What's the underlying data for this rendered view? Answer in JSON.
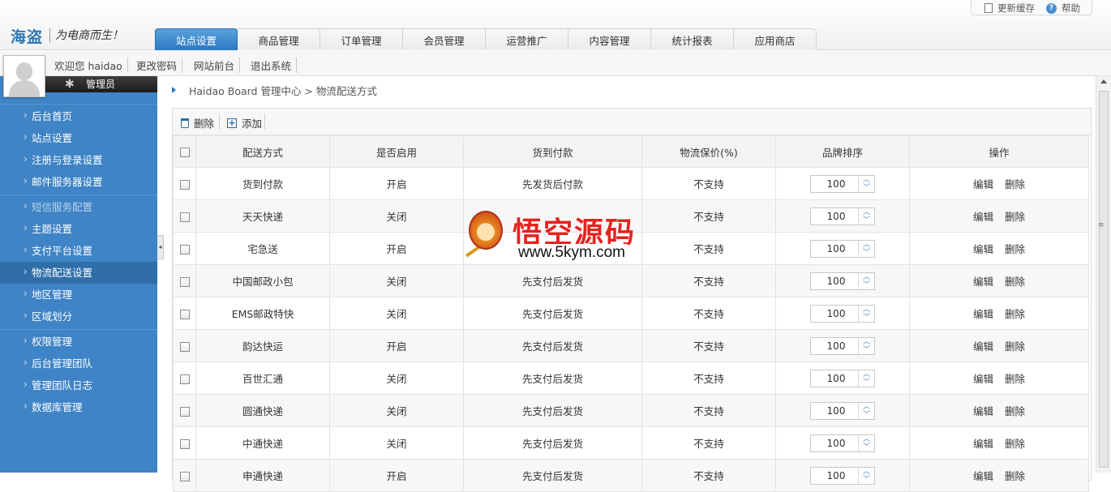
{
  "header": {
    "logo": "海盗",
    "slogan": "为电商而生！",
    "top_links": {
      "refresh_cache": "更新缓存",
      "help": "帮助"
    },
    "tabs": [
      {
        "label": "站点设置",
        "active": true
      },
      {
        "label": "商品管理"
      },
      {
        "label": "订单管理"
      },
      {
        "label": "会员管理"
      },
      {
        "label": "运营推广"
      },
      {
        "label": "内容管理"
      },
      {
        "label": "统计报表"
      },
      {
        "label": "应用商店"
      }
    ]
  },
  "userbar": {
    "welcome": "欢迎您 haidao",
    "change_password": "更改密码",
    "site_front": "网站前台",
    "logout": "退出系统"
  },
  "sidebar": {
    "role": "管理员",
    "groups": [
      [
        {
          "label": "后台首页"
        },
        {
          "label": "站点设置"
        },
        {
          "label": "注册与登录设置"
        },
        {
          "label": "邮件服务器设置"
        }
      ],
      [
        {
          "label": "短信服务配置",
          "dim": true
        },
        {
          "label": "主题设置"
        },
        {
          "label": "支付平台设置"
        },
        {
          "label": "物流配送设置",
          "active": true
        },
        {
          "label": "地区管理"
        },
        {
          "label": "区域划分"
        }
      ],
      [
        {
          "label": "权限管理"
        },
        {
          "label": "后台管理团队"
        },
        {
          "label": "管理团队日志"
        },
        {
          "label": "数据库管理"
        }
      ]
    ]
  },
  "breadcrumb": "Haidao Board 管理中心 > 物流配送方式",
  "toolbar": {
    "delete_label": "删除",
    "add_label": "添加"
  },
  "table": {
    "headers": [
      "配送方式",
      "是否启用",
      "货到付款",
      "物流保价(%)",
      "品牌排序",
      "操作"
    ],
    "actions": {
      "edit": "编辑",
      "delete": "删除"
    },
    "rows": [
      {
        "name": "货到付款",
        "enabled": "开启",
        "cod": "先发货后付款",
        "insure": "不支持",
        "sort": "100"
      },
      {
        "name": "天天快递",
        "enabled": "关闭",
        "cod": "",
        "insure": "不支持",
        "sort": "100"
      },
      {
        "name": "宅急送",
        "enabled": "开启",
        "cod": "",
        "insure": "不支持",
        "sort": "100"
      },
      {
        "name": "中国邮政小包",
        "enabled": "关闭",
        "cod": "先支付后发货",
        "insure": "不支持",
        "sort": "100"
      },
      {
        "name": "EMS邮政特快",
        "enabled": "关闭",
        "cod": "先支付后发货",
        "insure": "不支持",
        "sort": "100"
      },
      {
        "name": "韵达快运",
        "enabled": "开启",
        "cod": "先支付后发货",
        "insure": "不支持",
        "sort": "100"
      },
      {
        "name": "百世汇通",
        "enabled": "关闭",
        "cod": "先支付后发货",
        "insure": "不支持",
        "sort": "100"
      },
      {
        "name": "圆通快递",
        "enabled": "关闭",
        "cod": "先支付后发货",
        "insure": "不支持",
        "sort": "100"
      },
      {
        "name": "中通快递",
        "enabled": "关闭",
        "cod": "先支付后发货",
        "insure": "不支持",
        "sort": "100"
      },
      {
        "name": "申通快递",
        "enabled": "开启",
        "cod": "先支付后发货",
        "insure": "不支持",
        "sort": "100"
      }
    ]
  },
  "watermark": {
    "title": "悟空源码",
    "url": "www.5kym.com"
  },
  "colors": {
    "accent": "#2c78c0",
    "sidebar": "#3e84c6",
    "sidebar_active": "#2f6ea9",
    "watermark_red": "#e4231f"
  }
}
